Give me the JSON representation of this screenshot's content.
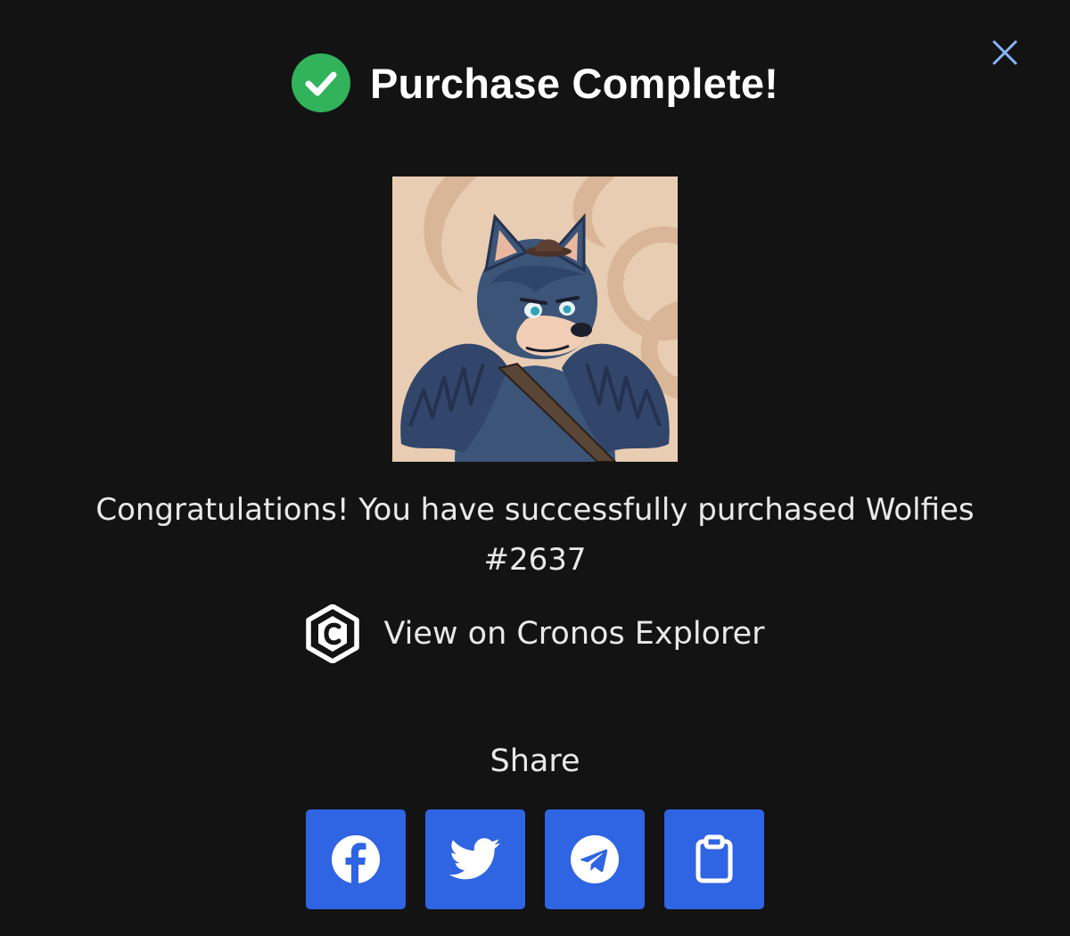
{
  "modal": {
    "title": "Purchase Complete!",
    "title_icon": "check-circle-icon",
    "close_icon": "close-icon",
    "nft_alt": "Wolfies #2637",
    "message": "Congratulations! You have successfully purchased Wolfies #2637",
    "explorer": {
      "icon": "cronos-logo-icon",
      "label": "View on Cronos Explorer"
    },
    "share": {
      "label": "Share",
      "buttons": [
        {
          "icon": "facebook-icon"
        },
        {
          "icon": "twitter-icon"
        },
        {
          "icon": "telegram-icon"
        },
        {
          "icon": "clipboard-icon"
        }
      ]
    }
  },
  "colors": {
    "background": "#131314",
    "success_green": "#31b25b",
    "share_button_blue": "#2f64e2",
    "close_icon_blue": "#8ab4ff",
    "text": "#e9e9e9"
  }
}
